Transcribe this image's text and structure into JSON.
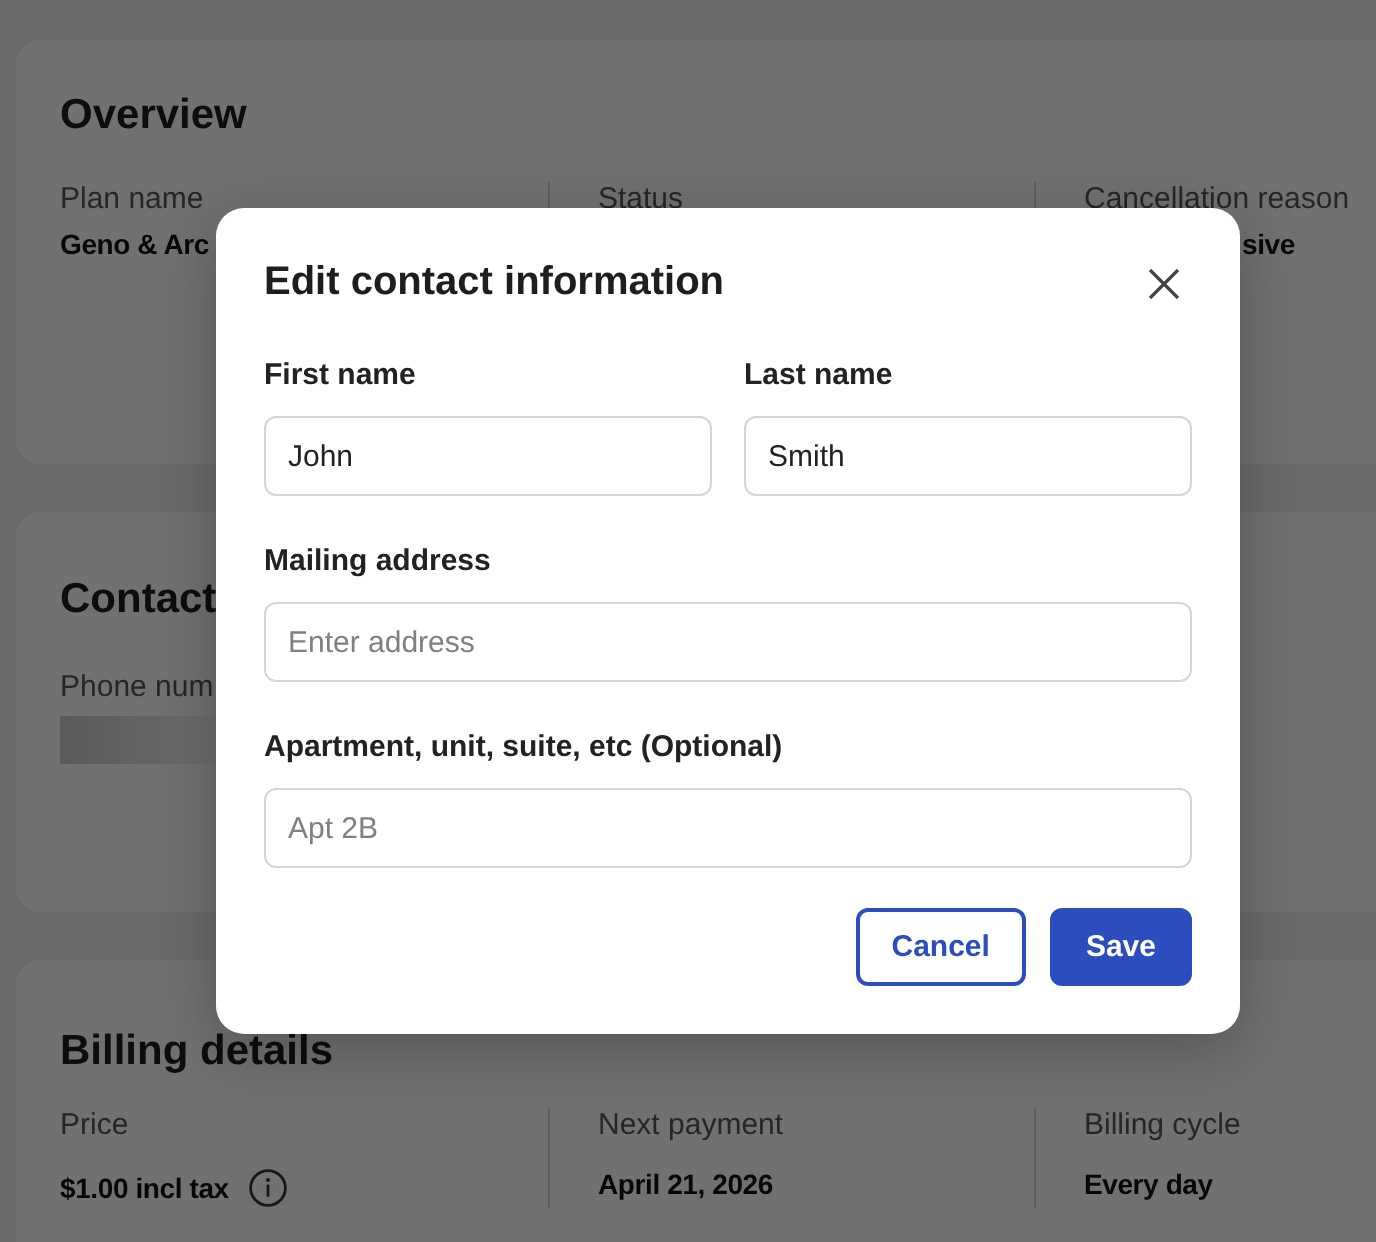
{
  "overview": {
    "title": "Overview",
    "fields": [
      {
        "label": "Plan name",
        "value": "Geno & Arc"
      },
      {
        "label": "Status"
      },
      {
        "label": "Cancellation reason",
        "value": "sive"
      }
    ]
  },
  "contact": {
    "title": "Contact",
    "fields": [
      {
        "label": "Phone num",
        "loading": true
      }
    ]
  },
  "billing": {
    "title": "Billing details",
    "fields": [
      {
        "label": "Price",
        "value": "$1.00 incl tax",
        "info": true
      },
      {
        "label": "Next payment",
        "value": "April 21, 2026",
        "info": false
      },
      {
        "label": "Billing cycle",
        "value": "Every day",
        "info": false
      }
    ]
  },
  "modal": {
    "title": "Edit contact information",
    "rows": [
      [
        {
          "label": "First name",
          "value": "John"
        },
        {
          "label": "Last name",
          "value": "Smith"
        }
      ],
      [
        {
          "label": "Mailing address",
          "placeholder": "Enter address"
        }
      ],
      [
        {
          "label": "Apartment, unit, suite, etc (Optional)",
          "placeholder": "Apt 2B"
        }
      ]
    ],
    "buttons": [
      {
        "label": "Cancel",
        "kind": "secondary"
      },
      {
        "label": "Save",
        "kind": "primary"
      }
    ]
  }
}
